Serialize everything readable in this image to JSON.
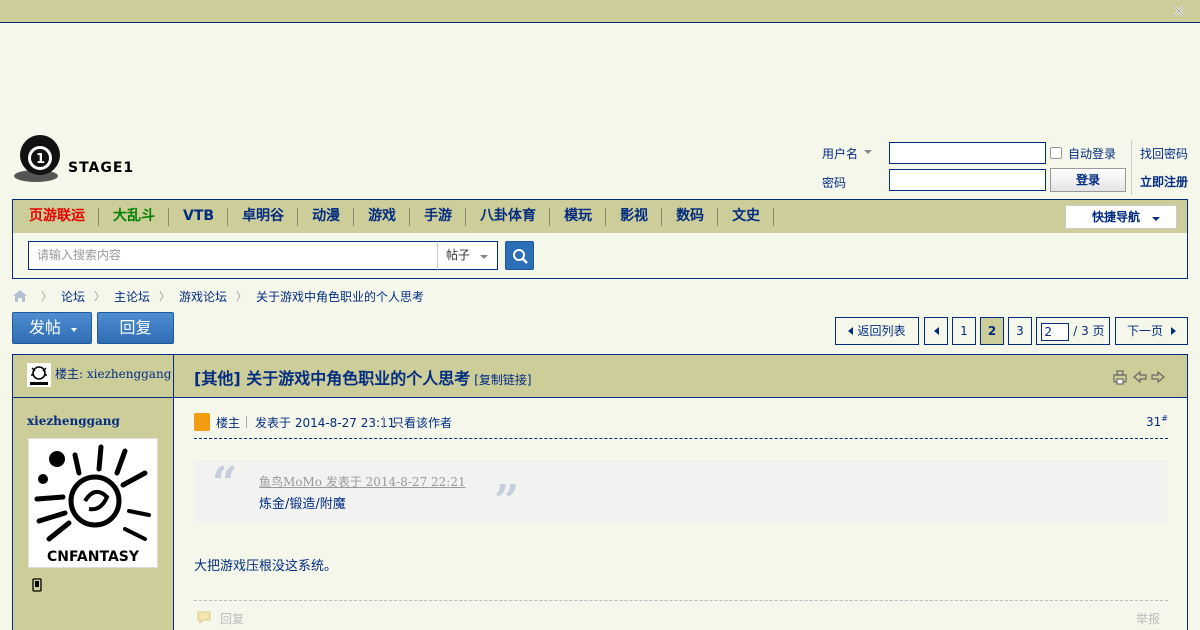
{
  "logo": {
    "brand": "STAGE1"
  },
  "login": {
    "username_label": "用户名",
    "password_label": "密码",
    "auto_login": "自动登录",
    "login_button": "登录",
    "forgot_password": "找回密码",
    "register": "立即注册"
  },
  "nav": {
    "items": [
      {
        "label": "页游联运",
        "color": "#e60000"
      },
      {
        "label": "大乱斗",
        "color": "#008000"
      },
      {
        "label": "VTB"
      },
      {
        "label": "卓明谷"
      },
      {
        "label": "动漫"
      },
      {
        "label": "游戏"
      },
      {
        "label": "手游"
      },
      {
        "label": "八卦体育"
      },
      {
        "label": "模玩"
      },
      {
        "label": "影视"
      },
      {
        "label": "数码"
      },
      {
        "label": "文史"
      }
    ],
    "quick_nav": "快捷导航"
  },
  "search": {
    "placeholder": "请输入搜索内容",
    "type": "帖子"
  },
  "breadcrumb": [
    "论坛",
    "主论坛",
    "游戏论坛",
    "关于游戏中角色职业的个人思考"
  ],
  "actions": {
    "post_button": "发帖",
    "reply_button": "回复"
  },
  "pager": {
    "back_to_list": "返回列表",
    "pages": [
      "1",
      "2",
      "3"
    ],
    "current_page": "2",
    "total": "/ 3 页",
    "next": "下一页"
  },
  "thread": {
    "op_label": "楼主: xiezhenggang",
    "title": "[其他] 关于游戏中角色职业的个人思考",
    "copy_link": "[复制链接]"
  },
  "post": {
    "author": "xiezhenggang",
    "avatar_text": "CNFANTASY",
    "role": "楼主",
    "posted_at": "发表于 2014-8-27 23:11",
    "only_author": "只看该作者",
    "floor": "31",
    "floor_sup": "#",
    "quote_source": "鱼鸟MoMo 发表于 2014-8-27 22:21",
    "quote_text": "炼金/锻造/附魔",
    "body": "大把游戏压根没这系统。",
    "reply": "回复",
    "report": "举报"
  },
  "colors": {
    "accent": "#022c80",
    "header_bg": "#cdcd9a",
    "page_bg": "#f6f7eb",
    "button_blue": "#2e6cb4"
  }
}
